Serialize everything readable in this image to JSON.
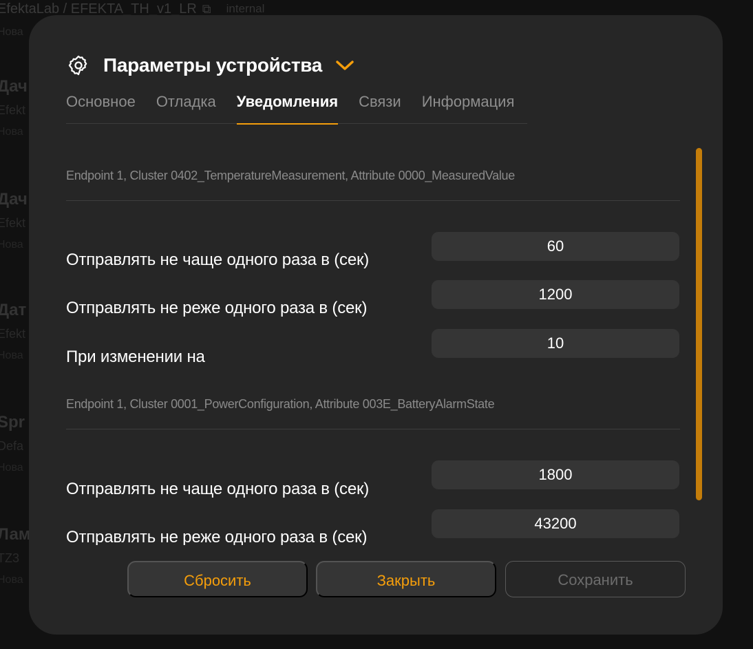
{
  "background": {
    "breadcrumb": "EfektaLab / EFEKTA_TH_v1_LR",
    "tag": "internal",
    "sub": "Нова",
    "items": [
      {
        "title": "Дач",
        "subtitle": "Efekt",
        "note": "Нова"
      },
      {
        "title": "Дач",
        "subtitle": "Efekt",
        "note": "Нова"
      },
      {
        "title": "Дат",
        "subtitle": "Efekt",
        "note": "Нова"
      },
      {
        "title": "Spr",
        "subtitle": "Defa",
        "note": "Нова"
      },
      {
        "title": "Лам",
        "subtitle": "TZ3",
        "note": "Нова"
      }
    ]
  },
  "modal": {
    "title": "Параметры устройства",
    "icons": {
      "settings": "gear-icon",
      "expand": "chevron-down-icon"
    },
    "tabs": [
      {
        "label": "Основное"
      },
      {
        "label": "Отладка"
      },
      {
        "label": "Уведомления",
        "active": true
      },
      {
        "label": "Связи"
      },
      {
        "label": "Информация"
      }
    ],
    "sections": [
      {
        "caption": "Endpoint 1, Cluster 0402_TemperatureMeasurement, Attribute 0000_MeasuredValue",
        "rows": [
          {
            "label": "Отправлять не чаще одного раза в (сек)",
            "value": "60"
          },
          {
            "label": "Отправлять не реже одного раза в (сек)",
            "value": "1200"
          },
          {
            "label": "При изменении на",
            "value": "10"
          }
        ]
      },
      {
        "caption": "Endpoint 1, Cluster 0001_PowerConfiguration, Attribute 003E_BatteryAlarmState",
        "rows": [
          {
            "label": "Отправлять не чаще одного раза в (сек)",
            "value": "1800"
          },
          {
            "label": "Отправлять не реже одного раза в (сек)",
            "value": "43200"
          }
        ]
      }
    ],
    "buttons": {
      "reset": "Сбросить",
      "close": "Закрыть",
      "save": "Сохранить"
    },
    "colors": {
      "accent": "#f59e0b",
      "scrollbar": "#c47d0a",
      "panel": "#262626",
      "input": "#353535"
    }
  }
}
